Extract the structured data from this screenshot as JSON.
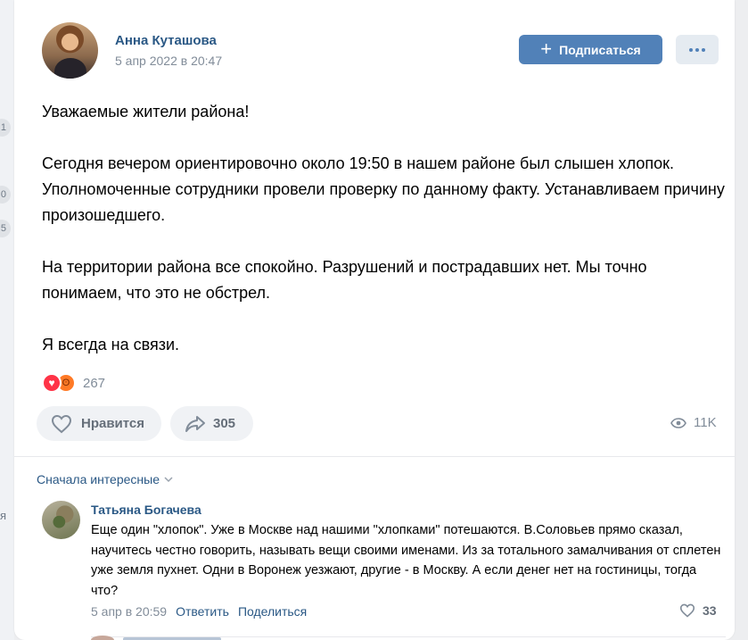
{
  "background": {
    "fragments": [
      "1",
      "0",
      "5"
    ],
    "side_text": "я"
  },
  "post": {
    "author": "Анна Куташова",
    "date": "5 апр 2022 в 20:47",
    "subscribe_label": "Подписаться",
    "paragraphs": [
      "Уважаемые жители района!",
      "Сегодня вечером ориентировочно около 19:50 в нашем районе был слышен хлопок. Уполномоченные сотрудники провели проверку по данному факту. Устанавливаем причину произошедшего.",
      "На территории района все спокойно. Разрушений и пострадавших нет. Мы точно понимаем, что это не обстрел.",
      "Я всегда на связи."
    ],
    "reaction_icons": [
      "heart-reaction-icon",
      "angry-reaction-icon"
    ],
    "reactions_count": "267",
    "like_label": "Нравится",
    "share_count": "305",
    "views": "11K"
  },
  "comments": {
    "sort_label": "Сначала интересные",
    "items": [
      {
        "author": "Татьяна Богачева",
        "text": "Еще один \"хлопок\". Уже в Москве над нашими \"хлопками\" потешаются. В.Соловьев прямо сказал, научитесь честно говорить, называть вещи своими именами. Из за тотального замалчивания от сплетен уже земля пухнет. Одни в Воронеж уезжают, другие - в Москву. А если денег нет на гостиницы, тогда что?",
        "date": "5 апр в 20:59",
        "reply_label": "Ответить",
        "share_label": "Поделиться",
        "likes": "33"
      }
    ]
  },
  "colors": {
    "accent": "#5181b8",
    "link": "#2a5885",
    "muted": "#818c99"
  }
}
